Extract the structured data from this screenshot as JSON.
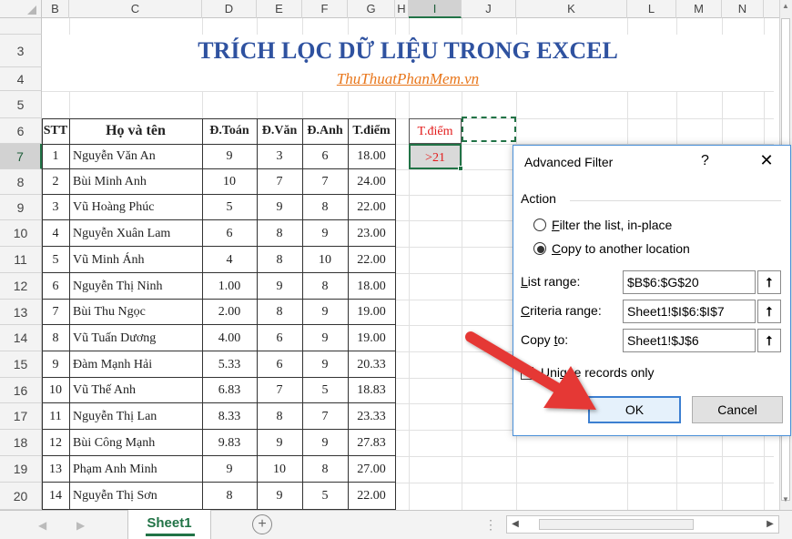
{
  "columns": [
    "B",
    "C",
    "D",
    "E",
    "F",
    "G",
    "H",
    "I",
    "J",
    "K",
    "L",
    "M",
    "N"
  ],
  "selected_column": "I",
  "rows": [
    "3",
    "4",
    "5",
    "6",
    "7",
    "8",
    "9",
    "10",
    "11",
    "12",
    "13",
    "14",
    "15",
    "16",
    "17",
    "18",
    "19",
    "20"
  ],
  "selected_row": "7",
  "title": "TRÍCH LỌC DỮ LIỆU TRONG EXCEL",
  "subtitle": "ThuThuatPhanMem.vn",
  "table": {
    "headers": [
      "STT",
      "Họ và tên",
      "Đ.Toán",
      "Đ.Văn",
      "Đ.Anh",
      "T.điểm"
    ],
    "rows": [
      [
        "1",
        "Nguyễn Văn An",
        "9",
        "3",
        "6",
        "18.00"
      ],
      [
        "2",
        "Bùi Minh Anh",
        "10",
        "7",
        "7",
        "24.00"
      ],
      [
        "3",
        "Vũ Hoàng Phúc",
        "5",
        "9",
        "8",
        "22.00"
      ],
      [
        "4",
        "Nguyễn Xuân Lam",
        "6",
        "8",
        "9",
        "23.00"
      ],
      [
        "5",
        "Vũ Minh Ánh",
        "4",
        "8",
        "10",
        "22.00"
      ],
      [
        "6",
        "Nguyễn Thị Ninh",
        "1.00",
        "9",
        "8",
        "18.00"
      ],
      [
        "7",
        "Bùi Thu Ngọc",
        "2.00",
        "8",
        "9",
        "19.00"
      ],
      [
        "8",
        "Vũ Tuấn Dương",
        "4.00",
        "6",
        "9",
        "19.00"
      ],
      [
        "9",
        "Đàm Mạnh Hải",
        "5.33",
        "6",
        "9",
        "20.33"
      ],
      [
        "10",
        "Vũ Thế Anh",
        "6.83",
        "7",
        "5",
        "18.83"
      ],
      [
        "11",
        "Nguyễn Thị Lan",
        "8.33",
        "8",
        "7",
        "23.33"
      ],
      [
        "12",
        "Bùi Công Mạnh",
        "9.83",
        "9",
        "9",
        "27.83"
      ],
      [
        "13",
        "Phạm Anh Minh",
        "9",
        "10",
        "8",
        "27.00"
      ],
      [
        "14",
        "Nguyễn Thị Sơn",
        "8",
        "9",
        "5",
        "22.00"
      ]
    ]
  },
  "criteria": {
    "header": "T.điểm",
    "value": ">21"
  },
  "sheet_tab": "Sheet1",
  "add_sheet": "+",
  "dialog": {
    "title": "Advanced Filter",
    "help": "?",
    "close": "✕",
    "action_label": "Action",
    "radio1_pre": "",
    "radio1_acc": "F",
    "radio1_post": "ilter the list, in-place",
    "radio2_pre": "",
    "radio2_acc": "C",
    "radio2_post": "opy to another location",
    "list_label_acc": "L",
    "list_label_post": "ist range:",
    "crit_label_acc": "C",
    "crit_label_post": "riteria range:",
    "copy_label_pre": "Copy ",
    "copy_label_acc": "t",
    "copy_label_post": "o:",
    "list_value": "$B$6:$G$20",
    "crit_value": "Sheet1!$I$6:$I$7",
    "copy_value": "Sheet1!$J$6",
    "pick_icon": "⭡",
    "unique_pre": "Uni",
    "unique_acc": "q",
    "unique_post": "ue records only",
    "ok": "OK",
    "cancel": "Cancel"
  }
}
